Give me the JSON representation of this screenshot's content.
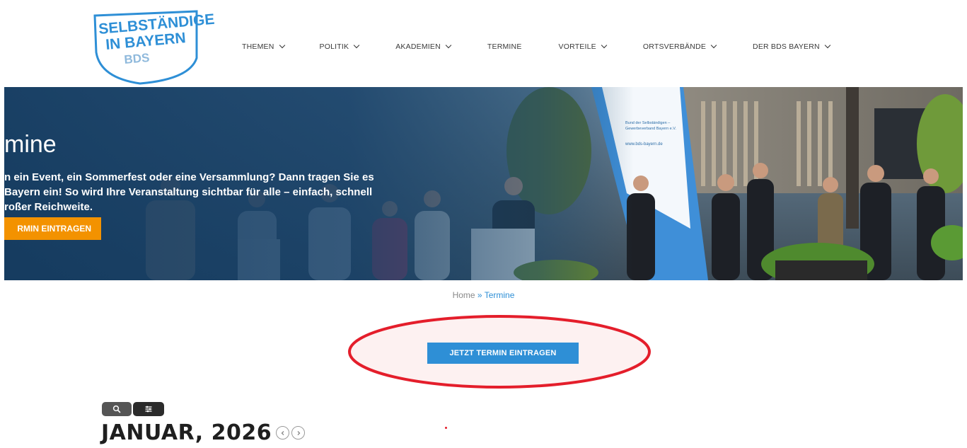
{
  "logo": {
    "line1": "SELBSTÄNDIGE",
    "line2": "IN BAYERN",
    "line3": "BDS"
  },
  "nav": {
    "items": [
      {
        "label": "THEMEN",
        "has_dropdown": true
      },
      {
        "label": "POLITIK",
        "has_dropdown": true
      },
      {
        "label": "AKADEMIEN",
        "has_dropdown": true
      },
      {
        "label": "TERMINE",
        "has_dropdown": false
      },
      {
        "label": "VORTEILE",
        "has_dropdown": true
      },
      {
        "label": "ORTSVERBÄNDE",
        "has_dropdown": true
      },
      {
        "label": "DER BDS BAYERN",
        "has_dropdown": true
      }
    ]
  },
  "hero": {
    "title": "mine",
    "text_line1": "n ein Event, ein Sommerfest oder eine Versammlung? Dann tragen Sie es",
    "text_line2": " Bayern ein! So wird Ihre Veranstaltung sichtbar für alle – einfach, schnell",
    "text_line3": "roßer Reichweite.",
    "button_label": "RMIN EINTRAGEN",
    "banner_text1": "Bund der Selbständigen –",
    "banner_text2": "Gewerbeverband Bayern e.V.",
    "banner_url": "www.bds-bayern.de"
  },
  "breadcrumb": {
    "home": "Home",
    "separator": " » ",
    "current": "Termine"
  },
  "cta": {
    "button_label": "JETZT TERMIN EINTRAGEN"
  },
  "calendar": {
    "month_title": "JANUAR, 2026"
  },
  "colors": {
    "brand_blue": "#2e8fd6",
    "orange": "#f39200",
    "highlight_red": "#e41e2b"
  }
}
